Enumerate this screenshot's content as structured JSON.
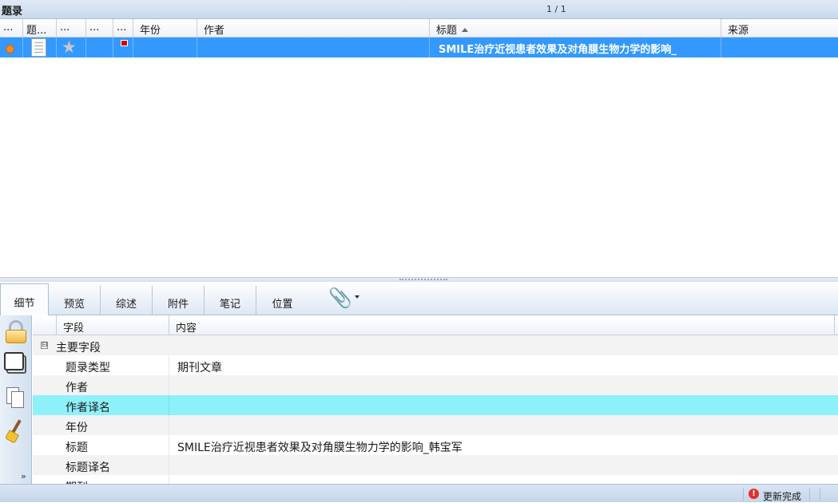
{
  "header": {
    "title": "题录",
    "pager": "1 / 1"
  },
  "columns": [
    {
      "label": "..."
    },
    {
      "label": "题..."
    },
    {
      "label": "..."
    },
    {
      "label": "..."
    },
    {
      "label": "..."
    },
    {
      "label": "年份"
    },
    {
      "label": "作者"
    },
    {
      "label": "标题"
    },
    {
      "label": "来源"
    }
  ],
  "sort_column": "标题",
  "records": [
    {
      "year": "",
      "author": "",
      "title": "SMILE治疗近视患者效果及对角膜生物力学的影响_",
      "source": "",
      "status_color": "#f08a24",
      "flag_color": "#d40000"
    }
  ],
  "tabs": [
    {
      "label": "细节"
    },
    {
      "label": "预览"
    },
    {
      "label": "综述"
    },
    {
      "label": "附件"
    },
    {
      "label": "笔记"
    },
    {
      "label": "位置"
    }
  ],
  "active_tab": "细节",
  "left_toolbar": [
    "lock-icon",
    "window-icon",
    "copy-icon",
    "broom-icon",
    "chevron-double-down-icon"
  ],
  "fields": {
    "col_field": "字段",
    "col_content": "内容",
    "group": "主要字段",
    "expander": "⊟",
    "rows": [
      {
        "key": "题录类型",
        "value": "期刊文章"
      },
      {
        "key": "作者",
        "value": ""
      },
      {
        "key": "作者译名",
        "value": ""
      },
      {
        "key": "年份",
        "value": ""
      },
      {
        "key": "标题",
        "value": "SMILE治疗近视患者效果及对角膜生物力学的影响_韩宝军"
      },
      {
        "key": "标题译名",
        "value": ""
      },
      {
        "key": "期刊",
        "value": ""
      }
    ]
  },
  "highlight_color": "#8ef1fa",
  "status": {
    "icon": "!",
    "text": "更新完成"
  }
}
